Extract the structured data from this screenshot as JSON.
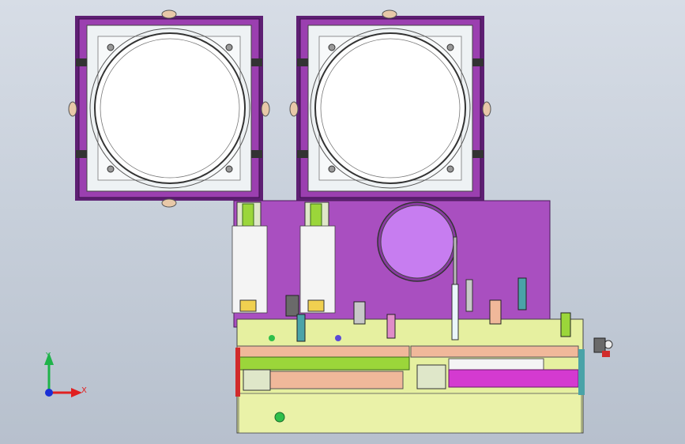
{
  "viewport": {
    "background_top": "#d7dde6",
    "background_bottom": "#b7c0cd"
  },
  "triad": {
    "y_label": "Y",
    "x_label": "X",
    "y_color": "#1fb34a",
    "x_color": "#e02020",
    "origin_color": "#1a2fd6"
  },
  "colors": {
    "frame_purple": "#9b3fb0",
    "frame_purple_dark": "#5e1f73",
    "plate_magenta": "#a94fc0",
    "disc_violet": "#c77df0",
    "base_yellow": "#e6f0a0",
    "rail_green": "#9bd63a",
    "rail_teal": "#4aa3a8",
    "belt_salmon": "#f0b89a",
    "belt_magenta": "#d43ad0",
    "accent_red": "#d12b2b",
    "pale_cyan": "#eaf6fb"
  }
}
